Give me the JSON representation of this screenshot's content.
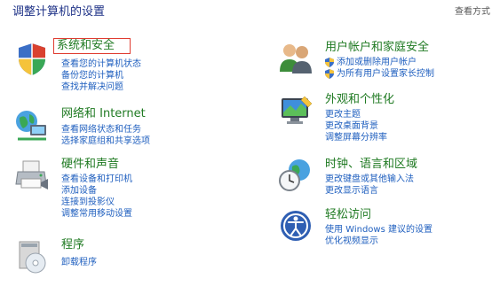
{
  "header": {
    "title": "调整计算机的设置",
    "view_by_label": "查看方式"
  },
  "left_categories": [
    {
      "name": "system-security",
      "icon": "shield-flag-icon",
      "title": "系统和安全",
      "links": [
        "查看您的计算机状态",
        "备份您的计算机",
        "查找并解决问题"
      ]
    },
    {
      "name": "network-internet",
      "icon": "network-globe-icon",
      "title": "网络和 Internet",
      "links": [
        "查看网络状态和任务",
        "选择家庭组和共享选项"
      ]
    },
    {
      "name": "hardware-sound",
      "icon": "printer-icon",
      "title": "硬件和声音",
      "links": [
        "查看设备和打印机",
        "添加设备",
        "连接到投影仪",
        "调整常用移动设置"
      ]
    },
    {
      "name": "programs",
      "icon": "programs-disc-icon",
      "title": "程序",
      "links": [
        "卸载程序"
      ]
    }
  ],
  "right_categories": [
    {
      "name": "user-accounts",
      "icon": "users-icon",
      "title": "用户帐户和家庭安全",
      "links": [
        "添加或删除用户帐户",
        "为所有用户设置家长控制"
      ],
      "shielded_links": [
        true,
        true
      ]
    },
    {
      "name": "appearance",
      "icon": "monitor-personalize-icon",
      "title": "外观和个性化",
      "links": [
        "更改主题",
        "更改桌面背景",
        "调整屏幕分辨率"
      ]
    },
    {
      "name": "clock-region",
      "icon": "clock-globe-icon",
      "title": "时钟、语言和区域",
      "links": [
        "更改键盘或其他输入法",
        "更改显示语言"
      ]
    },
    {
      "name": "ease-of-access",
      "icon": "ease-of-access-icon",
      "title": "轻松访问",
      "links": [
        "使用 Windows 建议的设置",
        "优化视频显示"
      ]
    }
  ],
  "colors": {
    "title": "#1e3287",
    "category": "#1f7a22",
    "link": "#1f5fbf",
    "highlight_box": "#e03c31"
  }
}
